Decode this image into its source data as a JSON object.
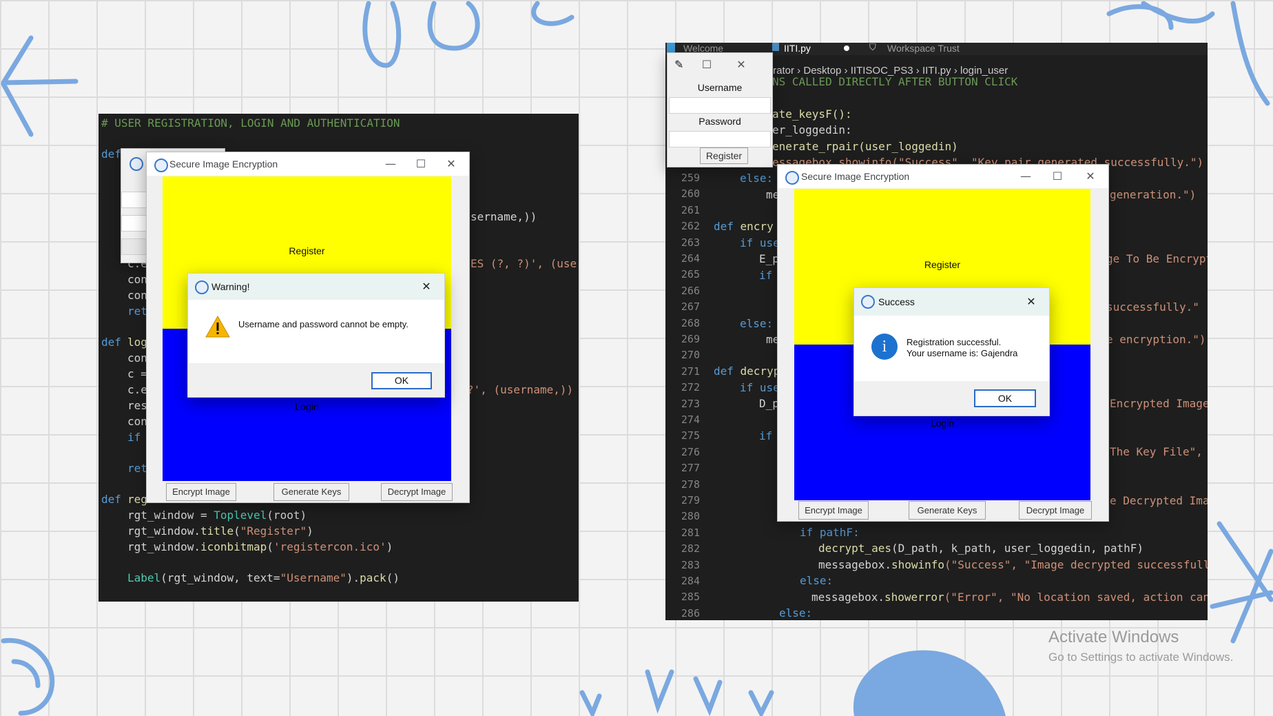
{
  "left_code": {
    "comment": "# USER REGISTRATION, LOGIN AND AUTHENTICATION",
    "def_kw": "def",
    "frag_username_args": "sername,))",
    "frag_values": "ES (?, ?)', (user",
    "frag_ce": "c.e",
    "frag_con1": "con",
    "frag_con2": "con",
    "frag_ret1": "ret",
    "frag_def_log": "log",
    "frag_con3": "con",
    "frag_c": "c =",
    "frag_ce2": "c.e",
    "frag_res": "res",
    "frag_con4": "con",
    "frag_if": "if",
    "frag_ret2": "ret",
    "frag_where": "?', (username,))",
    "frag_def_reg": "reg",
    "line_rgt1_var": "rgt_window = ",
    "line_rgt1_cls": "Toplevel",
    "line_rgt1_arg": "(root)",
    "line_rgt2_a": "rgt_window.",
    "line_rgt2_fn": "title",
    "line_rgt2_str": "\"Register\"",
    "line_rgt3_a": "rgt_window.",
    "line_rgt3_fn": "iconbitmap",
    "line_rgt3_str": "'registercon.ico'",
    "line_label_cls": "Label",
    "line_label_a": "(rgt_window, text=",
    "line_label_str": "\"Username\"",
    "line_label_fn": "pack"
  },
  "left_app": {
    "title": "Secure Image Encryption",
    "register_label": "Register",
    "login_label": "Login",
    "buttons": [
      "Encrypt Image",
      "Generate Keys",
      "Decrypt Image"
    ],
    "colors": {
      "top": "#ffff00",
      "bottom": "#0000ff"
    }
  },
  "warning_dialog": {
    "title": "Warning!",
    "message": "Username and password cannot be empty.",
    "ok": "OK"
  },
  "right_editor": {
    "tabs": [
      "Welcome",
      "IITI.py",
      "Workspace Trust"
    ],
    "breadcrumb": [
      "trator",
      "Desktop",
      "IITISOC_PS3",
      "IITI.py",
      "login_user"
    ],
    "line_numbers": [
      "259",
      "260",
      "261",
      "262",
      "263",
      "264",
      "265",
      "266",
      "267",
      "268",
      "269",
      "270",
      "271",
      "272",
      "273",
      "274",
      "275",
      "276",
      "277",
      "278",
      "279",
      "280",
      "281",
      "282",
      "283",
      "284",
      "285",
      "286"
    ],
    "frag_called": "NS CALLED DIRECTLY AFTER BUTTON CLICK",
    "frag_keysF": "ate_keysF():",
    "frag_loggedin": "er_loggedin:",
    "frag_rpair": "enerate_rpair(user_loggedin)",
    "frag_showinfo": "essagebox.showinfo(\"Success\", \"Key pair generated successfully.\")",
    "frag_else1": "else:",
    "frag_me1": "me",
    "frag_generation": "generation.\")",
    "frag_def_encry": "encry",
    "frag_if_use1": "if use",
    "frag_E_p": "E_p",
    "frag_if1": "if",
    "frag_to_be_encrypt": "ge To Be Encrypt",
    "frag_successfully": "successfully.\"",
    "frag_else2": "else:",
    "frag_me2": "me",
    "frag_encryption": "e encryption.\")",
    "frag_def_decryp": "decryp",
    "frag_if_use2": "if use",
    "frag_D_p": "D_p",
    "frag_encrypted_image": "Encrypted Image",
    "frag_if2": "if",
    "frag_key_file": "The Key File\", f",
    "frag_decrypted_imag": "e Decrypted Imag",
    "line281": "if pathF:",
    "line282_fn": "decrypt_aes",
    "line282_args": "(D_path, k_path, user_loggedin, pathF)",
    "line283_a": "messagebox.",
    "line283_fn": "showinfo",
    "line283_str": "(\"Success\", \"Image decrypted successfully",
    "line284": "else:",
    "line285_a": "messagebox.",
    "line285_fn": "showerror",
    "line285_str": "(\"Error\", \"No location saved, action canc",
    "line286": "else:"
  },
  "register_window": {
    "username_label": "Username",
    "password_label": "Password",
    "register_button": "Register"
  },
  "right_app": {
    "title": "Secure Image Encryption",
    "register_label": "Register",
    "login_label": "Login",
    "buttons": [
      "Encrypt Image",
      "Generate Keys",
      "Decrypt Image"
    ]
  },
  "success_dialog": {
    "title": "Success",
    "message_line1": "Registration successful.",
    "message_line2": "Your username is: Gajendra",
    "ok": "OK"
  },
  "activation": {
    "title": "Activate Windows",
    "subtitle": "Go to Settings to activate Windows."
  }
}
